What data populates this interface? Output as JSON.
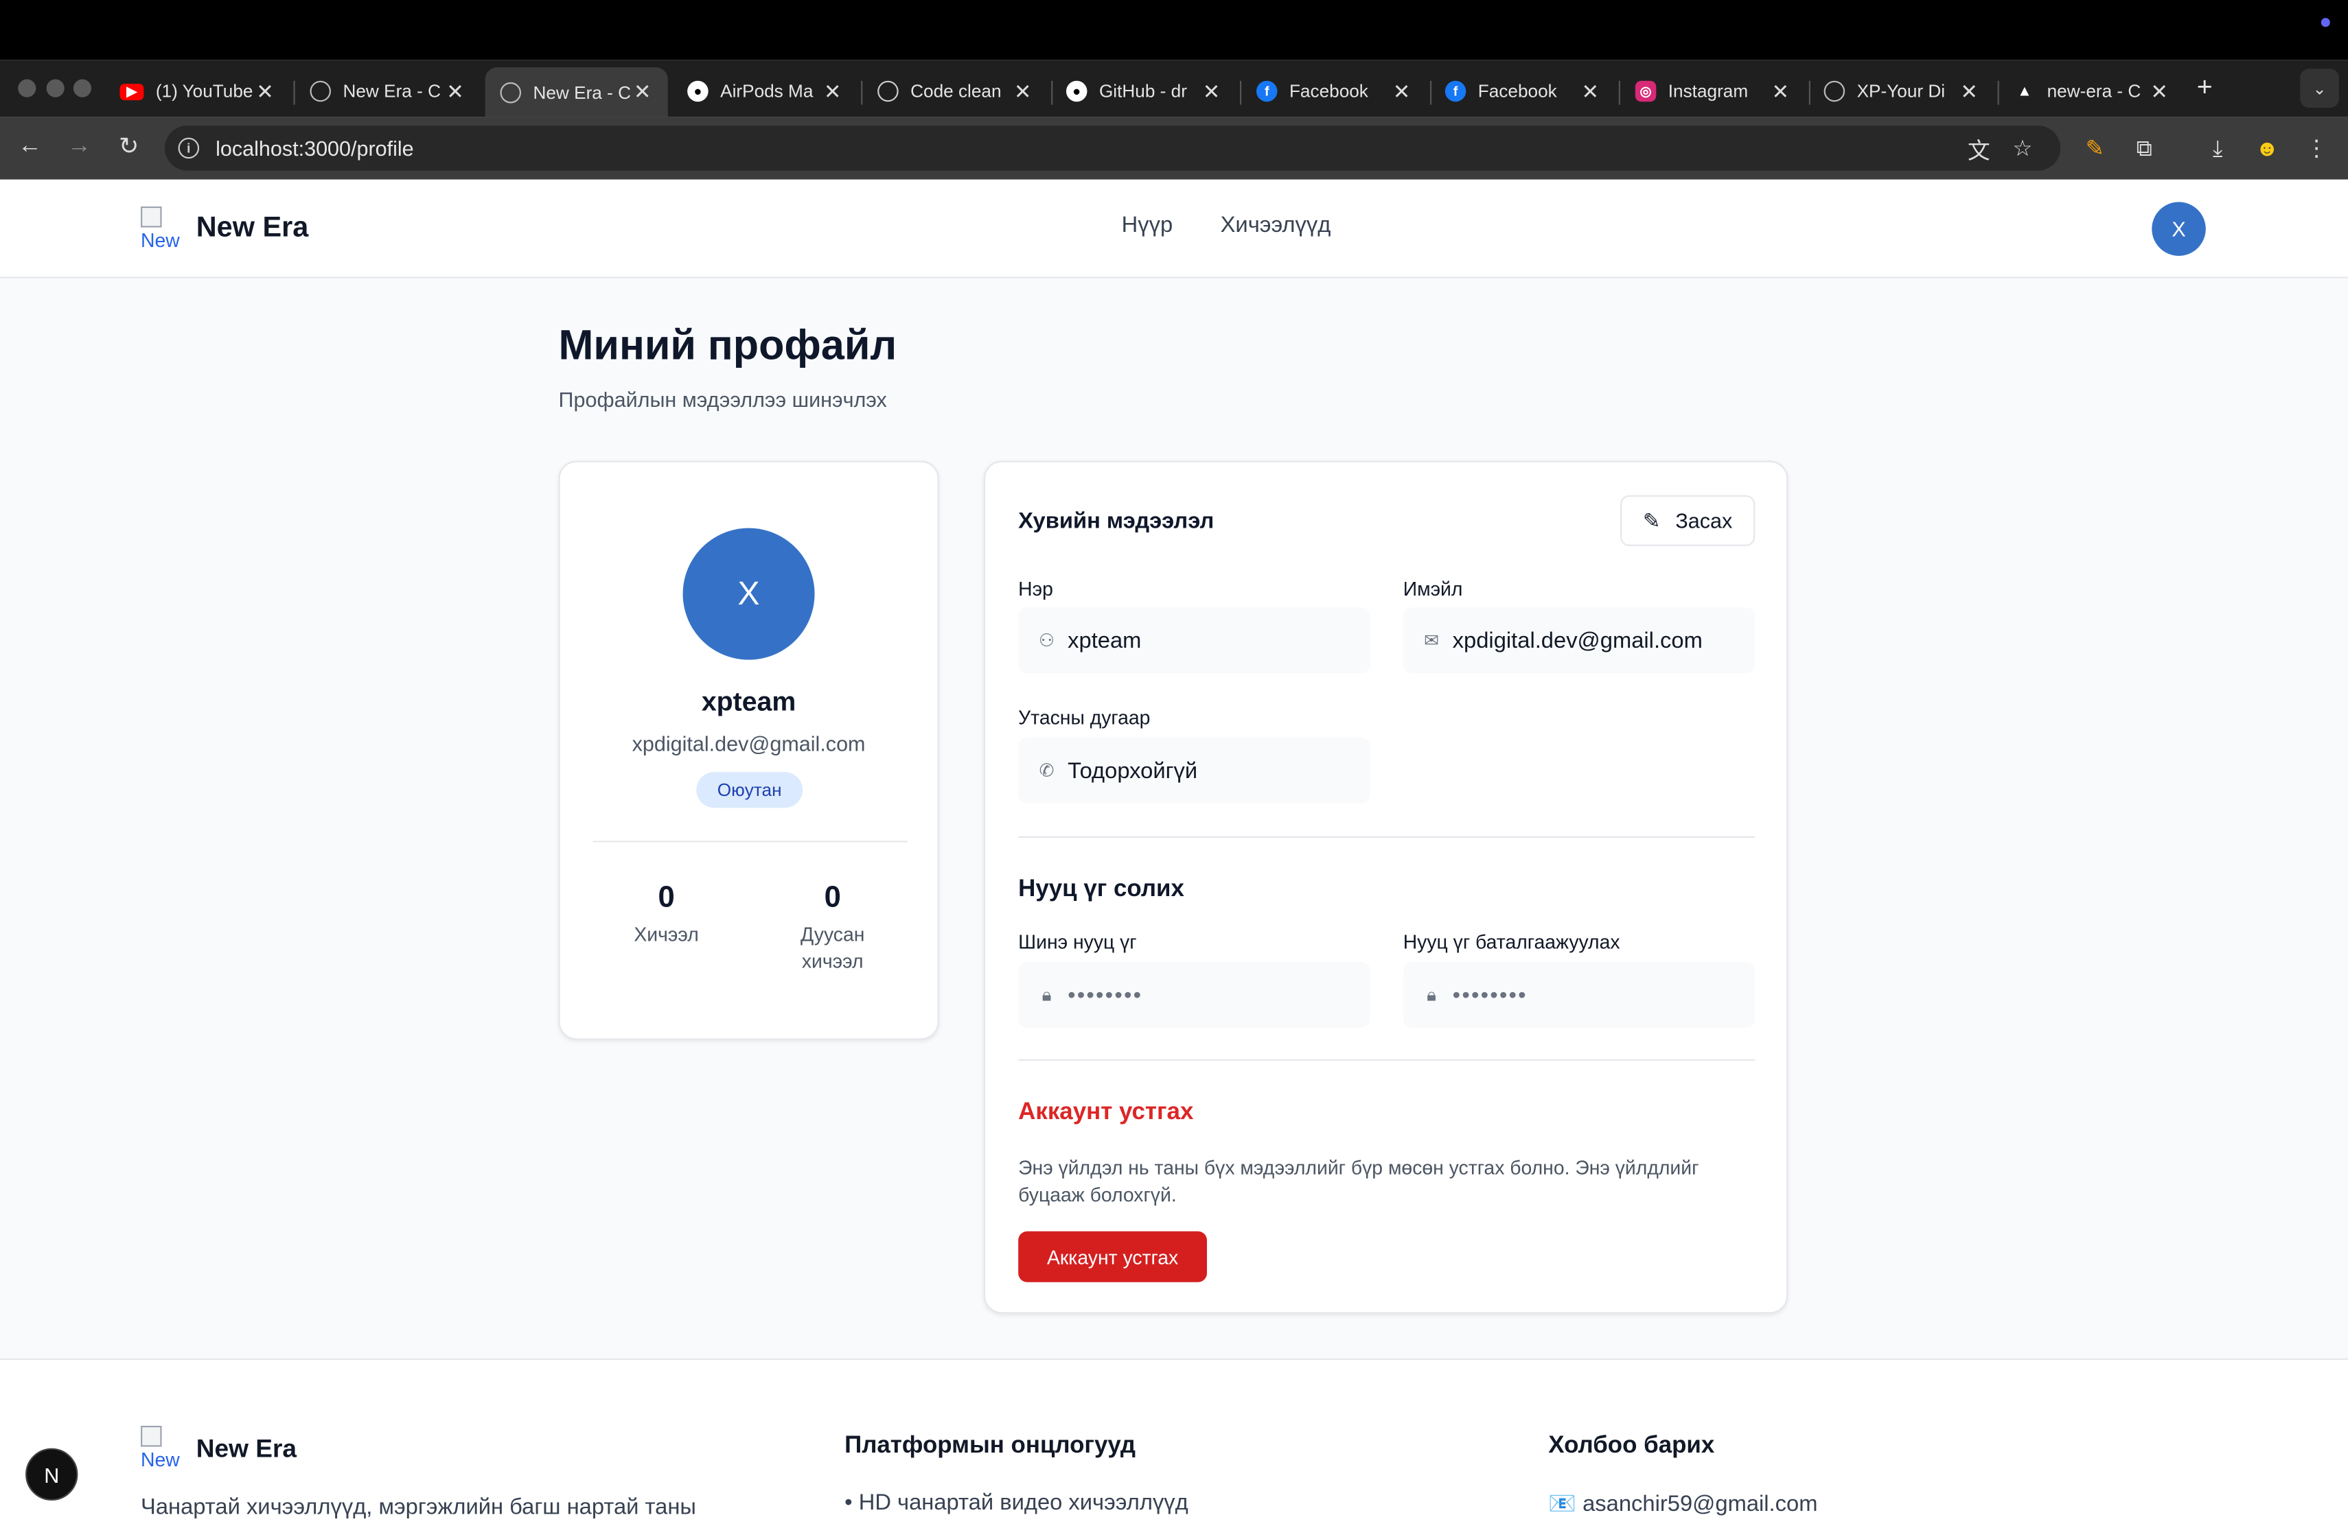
{
  "browser": {
    "tabs": [
      {
        "title": "(1) YouTube",
        "favicon": "youtube-icon",
        "color": "#ff0000"
      },
      {
        "title": "New Era - C",
        "favicon": "globe-icon",
        "color": "#9ca3af"
      },
      {
        "title": "New Era - C",
        "favicon": "globe-icon",
        "color": "#9ca3af",
        "active": true
      },
      {
        "title": "AirPods Ma",
        "favicon": "apple-icon",
        "color": "#ffffff"
      },
      {
        "title": "Code clean",
        "favicon": "openai-icon",
        "color": "#9ca3af"
      },
      {
        "title": "GitHub - dr",
        "favicon": "github-icon",
        "color": "#ffffff"
      },
      {
        "title": "Facebook",
        "favicon": "facebook-icon",
        "color": "#1877f2"
      },
      {
        "title": "Facebook",
        "favicon": "facebook-icon",
        "color": "#1877f2"
      },
      {
        "title": "Instagram",
        "favicon": "instagram-icon",
        "color": "#d62976"
      },
      {
        "title": "XP-Your Di",
        "favicon": "globe-icon",
        "color": "#9ca3af"
      },
      {
        "title": "new-era - C",
        "favicon": "vercel-icon",
        "color": "#ffffff"
      }
    ],
    "url": "localhost:3000/profile"
  },
  "header": {
    "brand": "New Era",
    "logo_alt": "New",
    "nav": [
      "Нүүр",
      "Хичээлүүд"
    ],
    "avatar_initial": "X"
  },
  "page": {
    "title": "Миний профайл",
    "subtitle": "Профайлын мэдээллээ шинэчлэх"
  },
  "profile_card": {
    "avatar_initial": "X",
    "name": "xpteam",
    "email": "xpdigital.dev@gmail.com",
    "role": "Оюутан",
    "stats": [
      {
        "value": "0",
        "label": "Хичээл"
      },
      {
        "value": "0",
        "label": "Дуусан хичээл"
      }
    ]
  },
  "personal_info": {
    "title": "Хувийн мэдээлэл",
    "edit_label": "Засах",
    "fields": {
      "name": {
        "label": "Нэр",
        "value": "xpteam"
      },
      "email": {
        "label": "Имэйл",
        "value": "xpdigital.dev@gmail.com"
      },
      "phone": {
        "label": "Утасны дугаар",
        "value": "Тодорхойгүй"
      }
    }
  },
  "password": {
    "title": "Нууц үг солих",
    "new_label": "Шинэ нууц үг",
    "confirm_label": "Нууц үг баталгаажуулах",
    "masked": "••••••••"
  },
  "danger": {
    "title": "Аккаунт устгах",
    "text": "Энэ үйлдэл нь таны бүх мэдээллийг бүр мөсөн устгах болно. Энэ үйлдлийг буцааж болохгүй.",
    "button": "Аккаунт устгах"
  },
  "footer": {
    "brand": "New Era",
    "logo_alt": "New",
    "description": "Чанартай хичээллүүд, мэргэжлийн багш нартай таны",
    "features_title": "Платформын онцлогууд",
    "features_item": "• HD чанартай видео хичээллүүд",
    "contact_title": "Холбоо барих",
    "contact_email": "📧 asanchir59@gmail.com"
  },
  "dev_badge": "N",
  "colors": {
    "primary_avatar": "#3572c7",
    "danger": "#d51f1f",
    "badge_bg": "#dbeafe"
  }
}
